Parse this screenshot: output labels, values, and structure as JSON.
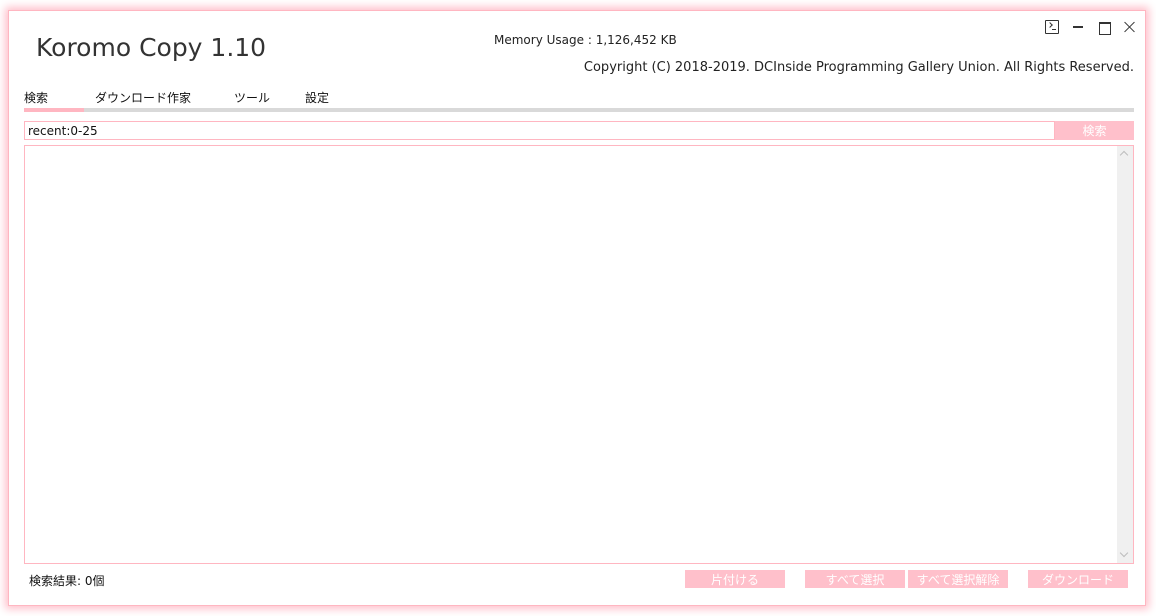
{
  "app": {
    "title": "Koromo Copy 1.10",
    "memory_label": "Memory Usage :",
    "memory_value": "1,126,452 KB",
    "copyright": "Copyright (C) 2018-2019. DCInside Programming Gallery Union. All Rights Reserved."
  },
  "window_controls": {
    "icons": [
      "console-icon",
      "minimize-icon",
      "maximize-icon",
      "close-icon"
    ]
  },
  "tabs": [
    {
      "label": "検索",
      "active": true
    },
    {
      "label": "ダウンロード作家",
      "active": false
    },
    {
      "label": "ツール",
      "active": false
    },
    {
      "label": "設定",
      "active": false
    }
  ],
  "search": {
    "value": "recent:0-25",
    "button_label": "検索"
  },
  "status": {
    "result_count_text": "検索結果: 0個"
  },
  "actions": {
    "tidy_label": "片付ける",
    "select_all_label": "すべて選択",
    "deselect_all_label": "すべて選択解除",
    "download_label": "ダウンロード"
  },
  "colors": {
    "accent": "#ffc0cb",
    "border": "#ffb6c1",
    "tab_track": "#d9d9d9"
  }
}
